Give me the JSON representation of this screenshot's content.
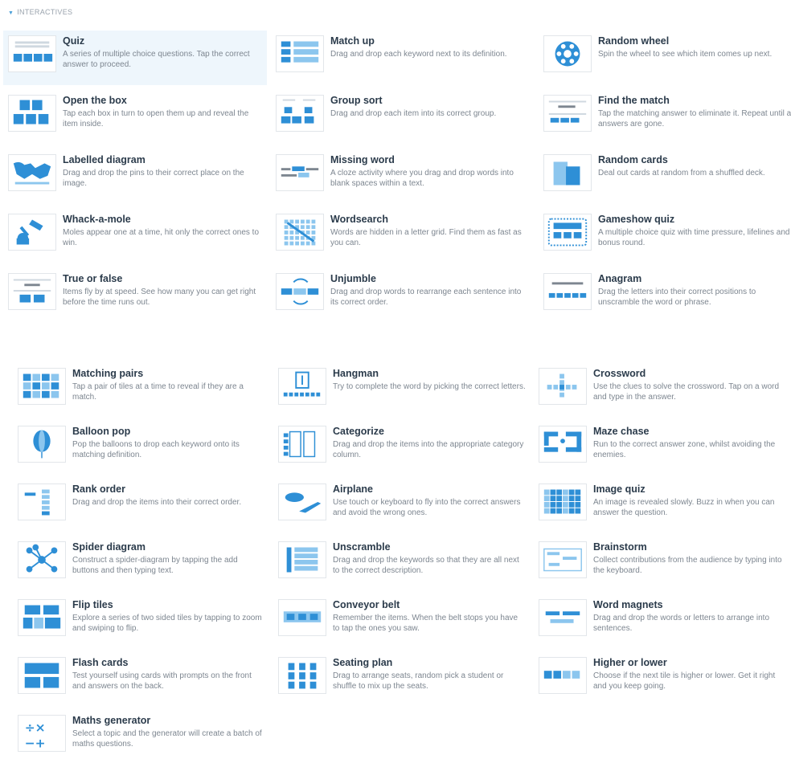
{
  "section": {
    "label": "INTERACTIVES"
  },
  "top_grid": [
    {
      "name": "Quiz",
      "desc": "A series of multiple choice questions. Tap the correct answer to proceed.",
      "icon": "quiz-icon",
      "selected": true
    },
    {
      "name": "Match up",
      "desc": "Drag and drop each keyword next to its definition.",
      "icon": "match-up-icon"
    },
    {
      "name": "Random wheel",
      "desc": "Spin the wheel to see which item comes up next.",
      "icon": "random-wheel-icon"
    },
    {
      "name": "Open the box",
      "desc": "Tap each box in turn to open them up and reveal the item inside.",
      "icon": "open-the-box-icon"
    },
    {
      "name": "Group sort",
      "desc": "Drag and drop each item into its correct group.",
      "icon": "group-sort-icon"
    },
    {
      "name": "Find the match",
      "desc": "Tap the matching answer to eliminate it. Repeat until all answers are gone.",
      "icon": "find-the-match-icon"
    },
    {
      "name": "Labelled diagram",
      "desc": "Drag and drop the pins to their correct place on the image.",
      "icon": "labelled-diagram-icon"
    },
    {
      "name": "Missing word",
      "desc": "A cloze activity where you drag and drop words into blank spaces within a text.",
      "icon": "missing-word-icon"
    },
    {
      "name": "Random cards",
      "desc": "Deal out cards at random from a shuffled deck.",
      "icon": "random-cards-icon"
    },
    {
      "name": "Whack-a-mole",
      "desc": "Moles appear one at a time, hit only the correct ones to win.",
      "icon": "whack-a-mole-icon"
    },
    {
      "name": "Wordsearch",
      "desc": "Words are hidden in a letter grid. Find them as fast as you can.",
      "icon": "wordsearch-icon"
    },
    {
      "name": "Gameshow quiz",
      "desc": "A multiple choice quiz with time pressure, lifelines and a bonus round.",
      "icon": "gameshow-quiz-icon"
    },
    {
      "name": "True or false",
      "desc": "Items fly by at speed. See how many you can get right before the time runs out.",
      "icon": "true-or-false-icon"
    },
    {
      "name": "Unjumble",
      "desc": "Drag and drop words to rearrange each sentence into its correct order.",
      "icon": "unjumble-icon"
    },
    {
      "name": "Anagram",
      "desc": "Drag the letters into their correct positions to unscramble the word or phrase.",
      "icon": "anagram-icon"
    }
  ],
  "bottom_grid": [
    {
      "name": "Matching pairs",
      "desc": "Tap a pair of tiles at a time to reveal if they are a match.",
      "icon": "matching-pairs-icon"
    },
    {
      "name": "Hangman",
      "desc": "Try to complete the word by picking the correct letters.",
      "icon": "hangman-icon"
    },
    {
      "name": "Crossword",
      "desc": "Use the clues to solve the crossword. Tap on a word and type in the answer.",
      "icon": "crossword-icon"
    },
    {
      "name": "Balloon pop",
      "desc": "Pop the balloons to drop each keyword onto its matching definition.",
      "icon": "balloon-pop-icon"
    },
    {
      "name": "Categorize",
      "desc": "Drag and drop the items into the appropriate category column.",
      "icon": "categorize-icon"
    },
    {
      "name": "Maze chase",
      "desc": "Run to the correct answer zone, whilst avoiding the enemies.",
      "icon": "maze-chase-icon"
    },
    {
      "name": "Rank order",
      "desc": "Drag and drop the items into their correct order.",
      "icon": "rank-order-icon"
    },
    {
      "name": "Airplane",
      "desc": "Use touch or keyboard to fly into the correct answers and avoid the wrong ones.",
      "icon": "airplane-icon"
    },
    {
      "name": "Image quiz",
      "desc": "An image is revealed slowly. Buzz in when you can answer the question.",
      "icon": "image-quiz-icon"
    },
    {
      "name": "Spider diagram",
      "desc": "Construct a spider-diagram by tapping the add buttons and then typing text.",
      "icon": "spider-diagram-icon"
    },
    {
      "name": "Unscramble",
      "desc": "Drag and drop the keywords so that they are all next to the correct description.",
      "icon": "unscramble-icon"
    },
    {
      "name": "Brainstorm",
      "desc": "Collect contributions from the audience by typing into the keyboard.",
      "icon": "brainstorm-icon"
    },
    {
      "name": "Flip tiles",
      "desc": "Explore a series of two sided tiles by tapping to zoom and swiping to flip.",
      "icon": "flip-tiles-icon"
    },
    {
      "name": "Conveyor belt",
      "desc": "Remember the items. When the belt stops you have to tap the ones you saw.",
      "icon": "conveyor-belt-icon"
    },
    {
      "name": "Word magnets",
      "desc": "Drag and drop the words or letters to arrange into sentences.",
      "icon": "word-magnets-icon"
    },
    {
      "name": "Flash cards",
      "desc": "Test yourself using cards with prompts on the front and answers on the back.",
      "icon": "flash-cards-icon"
    },
    {
      "name": "Seating plan",
      "desc": "Drag to arrange seats, random pick a student or shuffle to mix up the seats.",
      "icon": "seating-plan-icon"
    },
    {
      "name": "Higher or lower",
      "desc": "Choose if the next tile is higher or lower. Get it right and you keep going.",
      "icon": "higher-or-lower-icon"
    },
    {
      "name": "Maths generator",
      "desc": "Select a topic and the generator will create a batch of maths questions.",
      "icon": "maths-generator-icon"
    }
  ],
  "colors": {
    "accent": "#2e8fd6",
    "accent_light": "#8cc6ee",
    "selected_bg": "#eef6fc",
    "title": "#2b3b4b",
    "desc": "#7d8690"
  }
}
